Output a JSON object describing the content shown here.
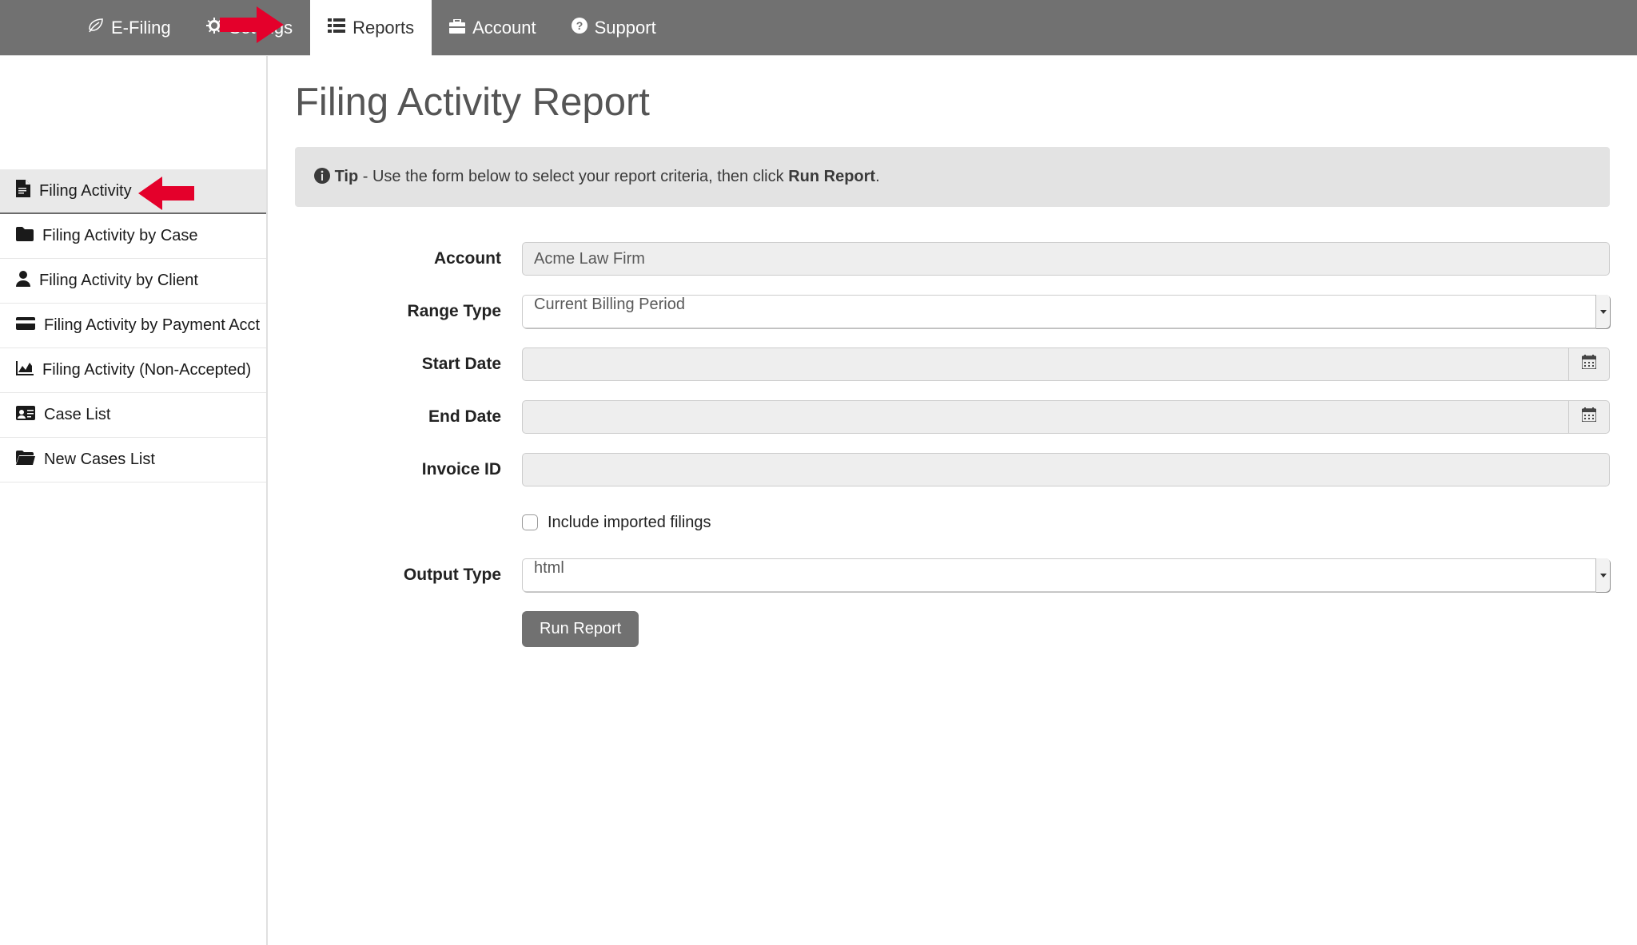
{
  "topnav": {
    "items": [
      {
        "label": "E-Filing",
        "icon": "leaf",
        "active": false
      },
      {
        "label": "Settings",
        "icon": "gear",
        "active": false
      },
      {
        "label": "Reports",
        "icon": "list",
        "active": true
      },
      {
        "label": "Account",
        "icon": "briefcase",
        "active": false
      },
      {
        "label": "Support",
        "icon": "question",
        "active": false
      }
    ]
  },
  "sidebar": {
    "items": [
      {
        "label": "Filing Activity",
        "icon": "file",
        "active": true
      },
      {
        "label": "Filing Activity by Case",
        "icon": "folder",
        "active": false
      },
      {
        "label": "Filing Activity by Client",
        "icon": "user",
        "active": false
      },
      {
        "label": "Filing Activity by Payment Acct",
        "icon": "card",
        "active": false
      },
      {
        "label": "Filing Activity (Non-Accepted)",
        "icon": "area-chart",
        "active": false
      },
      {
        "label": "Case List",
        "icon": "id",
        "active": false
      },
      {
        "label": "New Cases List",
        "icon": "folder-open",
        "active": false
      }
    ]
  },
  "page": {
    "title": "Filing Activity Report",
    "tip_prefix": "Tip",
    "tip_middle": " - Use the form below to select your report criteria, then click ",
    "tip_action": "Run Report",
    "tip_suffix": "."
  },
  "form": {
    "account": {
      "label": "Account",
      "value": "Acme Law Firm"
    },
    "range": {
      "label": "Range Type",
      "value": "Current Billing Period"
    },
    "start": {
      "label": "Start Date",
      "value": ""
    },
    "end": {
      "label": "End Date",
      "value": ""
    },
    "invoice": {
      "label": "Invoice ID",
      "value": ""
    },
    "include": {
      "label": "Include imported filings",
      "checked": false
    },
    "output": {
      "label": "Output Type",
      "value": "html"
    },
    "run_label": "Run Report"
  }
}
